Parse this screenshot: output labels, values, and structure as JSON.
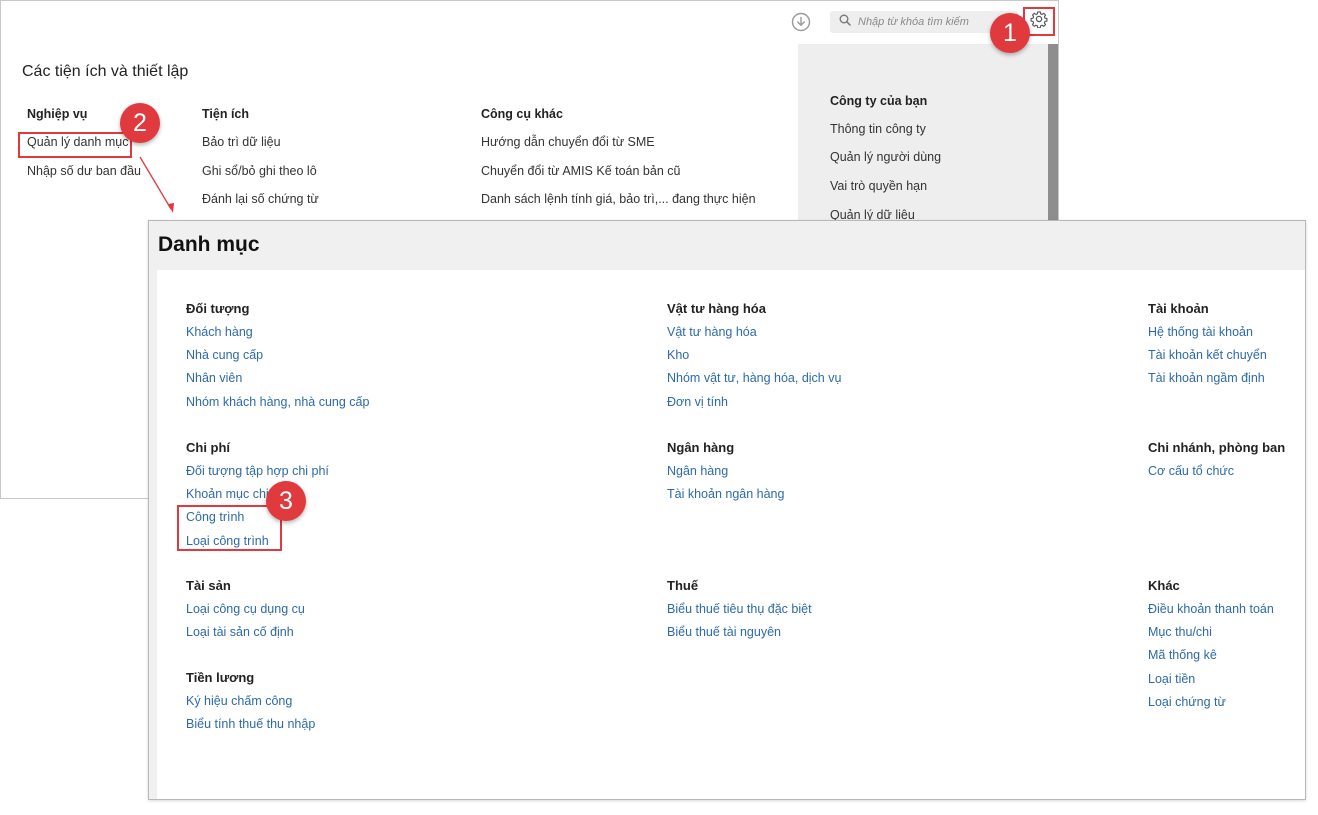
{
  "settings": {
    "search_placeholder": "Nhập từ khóa tìm kiếm",
    "heading": "Các tiện ích và thiết lập",
    "columns": [
      {
        "title": "Nghiệp vụ",
        "items": [
          "Quản lý danh mục",
          "Nhập số dư ban đầu"
        ]
      },
      {
        "title": "Tiện ích",
        "items": [
          "Bảo trì dữ liệu",
          "Ghi sổ/bỏ ghi theo lô",
          "Đánh lại số chứng từ"
        ]
      },
      {
        "title": "Công cụ khác",
        "items": [
          "Hướng dẫn chuyển đổi từ SME",
          "Chuyển đổi từ AMIS Kế toán bản cũ",
          "Danh sách lệnh tính giá, bảo trì,... đang thực hiện"
        ]
      }
    ],
    "company_panel": {
      "title": "Công ty của bạn",
      "items": [
        "Thông tin công ty",
        "Quản lý người dùng",
        "Vai trò quyền hạn",
        "Quản lý dữ liệu"
      ]
    }
  },
  "badges": [
    "1",
    "2",
    "3"
  ],
  "danhmuc": {
    "title": "Danh mục",
    "groups": [
      {
        "title": "Đối tượng",
        "links": [
          "Khách hàng",
          "Nhà cung cấp",
          "Nhân viên",
          "Nhóm khách hàng, nhà cung cấp"
        ]
      },
      {
        "title": "Vật tư hàng hóa",
        "links": [
          "Vật tư hàng hóa",
          "Kho",
          "Nhóm vật tư, hàng hóa, dịch vụ",
          "Đơn vị tính"
        ]
      },
      {
        "title": "Tài khoản",
        "links": [
          "Hệ thống tài khoản",
          "Tài khoản kết chuyển",
          "Tài khoản ngầm định"
        ]
      },
      {
        "title": "Chi phí",
        "links": [
          "Đối tượng tập hợp chi phí",
          "Khoản mục chi",
          "Công trình",
          "Loại công trình"
        ]
      },
      {
        "title": "Ngân hàng",
        "links": [
          "Ngân hàng",
          "Tài khoản ngân hàng"
        ]
      },
      {
        "title": "Chi nhánh, phòng ban",
        "links": [
          "Cơ cấu tổ chức"
        ]
      },
      {
        "title": "Tài sản",
        "links": [
          "Loại công cụ dụng cụ",
          "Loại tài sản cố định"
        ]
      },
      {
        "title": "Thuế",
        "links": [
          "Biểu thuế tiêu thụ đặc biệt",
          "Biểu thuế tài nguyên"
        ]
      },
      {
        "title": "Khác",
        "links": [
          "Điều khoản thanh toán",
          "Mục thu/chi",
          "Mã thống kê",
          "Loại tiền",
          "Loại chứng từ"
        ]
      },
      {
        "title": "Tiền lương",
        "links": [
          "Ký hiệu chấm công",
          "Biểu tính thuế thu nhập"
        ]
      }
    ]
  },
  "colors": {
    "accent_red": "#e0393e",
    "link_blue": "#2d6aa8"
  }
}
